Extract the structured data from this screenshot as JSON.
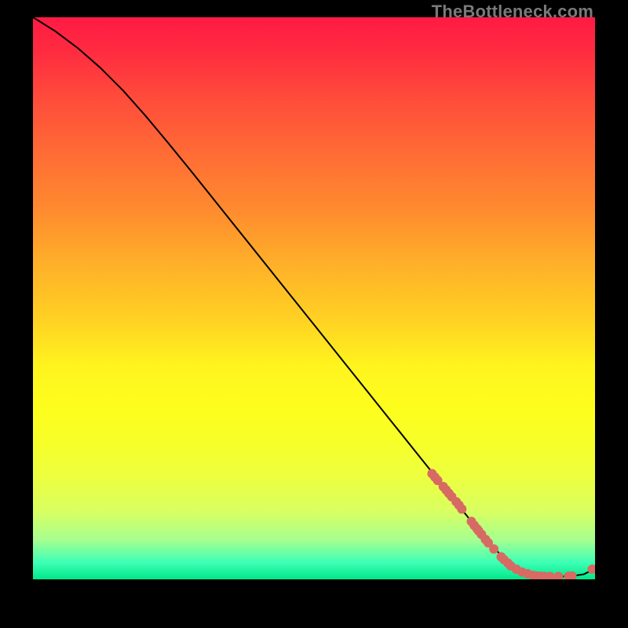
{
  "watermark": "TheBottleneck.com",
  "chart_data": {
    "type": "line",
    "title": "",
    "xlabel": "",
    "ylabel": "",
    "xlim": [
      0,
      100
    ],
    "ylim": [
      0,
      100
    ],
    "curve": {
      "x": [
        0,
        4,
        8,
        12,
        16,
        20,
        24,
        28,
        32,
        36,
        40,
        44,
        48,
        52,
        56,
        60,
        64,
        68,
        72,
        76,
        80,
        84,
        86,
        88,
        90,
        92,
        94,
        96,
        98,
        100
      ],
      "y": [
        100,
        97.5,
        94.5,
        91,
        87,
        82.5,
        77.7,
        72.8,
        67.8,
        62.8,
        57.8,
        52.8,
        47.8,
        42.8,
        37.8,
        32.8,
        27.8,
        22.8,
        17.8,
        12.8,
        7.8,
        3.5,
        2.0,
        1.0,
        0.6,
        0.5,
        0.5,
        0.6,
        0.9,
        1.9
      ]
    },
    "scatter": {
      "x": [
        71,
        71.5,
        72,
        73,
        73.5,
        74,
        74.5,
        75.3,
        75.8,
        76.3,
        78,
        78.5,
        79,
        79.3,
        79.8,
        80.5,
        81,
        82,
        83.3,
        83.8,
        84.5,
        85,
        86,
        87,
        88,
        89,
        89.6,
        90.3,
        91,
        92,
        93.5,
        95.3,
        95.9,
        99.5
      ],
      "y": [
        18.8,
        18.2,
        17.6,
        16.5,
        15.9,
        15.3,
        14.7,
        13.8,
        13.2,
        12.5,
        10.3,
        9.6,
        9.0,
        8.6,
        8.0,
        7.1,
        6.5,
        5.4,
        4.0,
        3.5,
        2.9,
        2.4,
        1.8,
        1.3,
        1.0,
        0.7,
        0.6,
        0.55,
        0.5,
        0.5,
        0.5,
        0.55,
        0.58,
        1.8
      ],
      "color": "#d76a63",
      "radius": 6
    }
  }
}
